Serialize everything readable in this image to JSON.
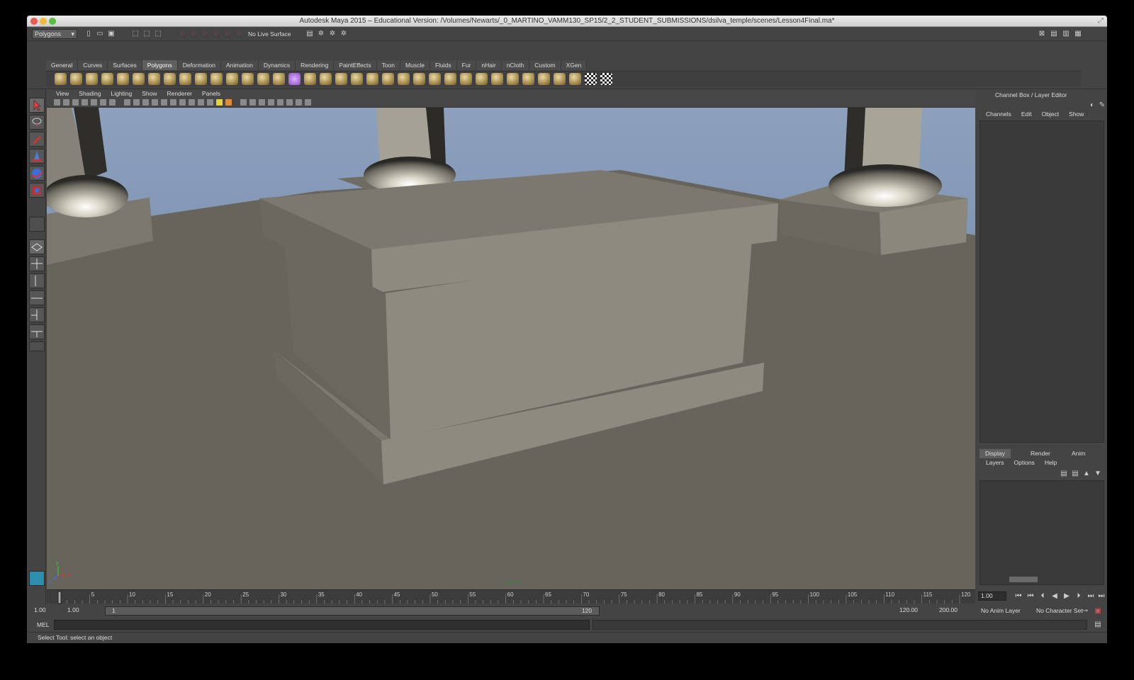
{
  "window": {
    "title": "Autodesk Maya 2015 – Educational Version: /Volumes/Newarts/_0_MARTINO_VAMM130_SP15/2_2_STUDENT_SUBMISSIONS/dsilva_temple/scenes/Lesson4Final.ma*"
  },
  "status_line": {
    "menu_set": "Polygons",
    "live_surface": "No Live Surface"
  },
  "shelf": {
    "tabs": [
      "General",
      "Curves",
      "Surfaces",
      "Polygons",
      "Deformation",
      "Animation",
      "Dynamics",
      "Rendering",
      "PaintEffects",
      "Toon",
      "Muscle",
      "Fluids",
      "Fur",
      "nHair",
      "nCloth",
      "Custom",
      "XGen"
    ],
    "active_tab": "Polygons"
  },
  "viewport": {
    "menu": [
      "View",
      "Shading",
      "Lighting",
      "Show",
      "Renderer",
      "Panels"
    ],
    "camera_label": "persp",
    "axis": {
      "x": "x",
      "y": "y",
      "z": "z"
    }
  },
  "channel_box": {
    "title": "Channel Box / Layer Editor",
    "menu": [
      "Channels",
      "Edit",
      "Object",
      "Show"
    ]
  },
  "layer_editor": {
    "tabs": [
      "Display",
      "Render",
      "Anim"
    ],
    "active_tab": "Display",
    "menu": [
      "Layers",
      "Options",
      "Help"
    ]
  },
  "timeline": {
    "ticks": [
      1,
      5,
      10,
      15,
      20,
      25,
      30,
      35,
      40,
      45,
      50,
      55,
      60,
      65,
      70,
      75,
      80,
      85,
      90,
      95,
      100,
      105,
      110,
      115,
      120
    ],
    "range": [
      1,
      120
    ],
    "current_frame": "1.00"
  },
  "range_slider": {
    "start_time": "1.00",
    "playback_start": "1.00",
    "slider_start": "1",
    "slider_end": "120",
    "playback_end": "120.00",
    "end_time": "200.00",
    "anim_layer": "No Anim Layer",
    "character_set": "No Character Set"
  },
  "command_line": {
    "label": "MEL"
  },
  "help_line": {
    "text": "Select Tool: select an object"
  },
  "colors": {
    "sky_top": "#8da1bd",
    "sky_bottom": "#5f7ba2",
    "ground": "#67645c",
    "pedestal_front": "#8f8a80",
    "pedestal_top": "#7c786f",
    "pedestal_side": "#6b6860",
    "active_tab": "#5f5f5f"
  }
}
